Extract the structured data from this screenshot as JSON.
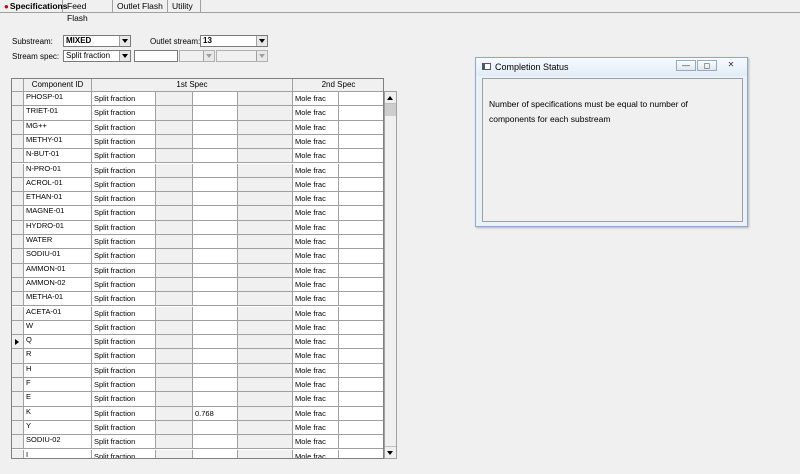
{
  "tabs": [
    {
      "label": "Specifications",
      "active": true
    },
    {
      "label": "Feed Flash",
      "active": false
    },
    {
      "label": "Outlet Flash",
      "active": false
    },
    {
      "label": "Utility",
      "active": false
    }
  ],
  "form": {
    "substream_label": "Substream:",
    "substream_value": "MIXED",
    "outlet_label": "Outlet stream:",
    "outlet_value": "13",
    "streamspec_label": "Stream spec:",
    "streamspec_value": "Split fraction"
  },
  "grid": {
    "headers": {
      "component": "Component ID",
      "spec1": "1st Spec",
      "spec2": "2nd Spec"
    },
    "selected_row_index": 17,
    "rows": [
      {
        "id": "PHOSP-01",
        "spec1": "Split fraction",
        "value": "",
        "spec2": "Mole frac"
      },
      {
        "id": "TRIET-01",
        "spec1": "Split fraction",
        "value": "",
        "spec2": "Mole frac"
      },
      {
        "id": "MG++",
        "spec1": "Split fraction",
        "value": "",
        "spec2": "Mole frac"
      },
      {
        "id": "METHY-01",
        "spec1": "Split fraction",
        "value": "",
        "spec2": "Mole frac"
      },
      {
        "id": "N-BUT-01",
        "spec1": "Split fraction",
        "value": "",
        "spec2": "Mole frac"
      },
      {
        "id": "N-PRO-01",
        "spec1": "Split fraction",
        "value": "",
        "spec2": "Mole frac"
      },
      {
        "id": "ACROL-01",
        "spec1": "Split fraction",
        "value": "",
        "spec2": "Mole frac"
      },
      {
        "id": "ETHAN-01",
        "spec1": "Split fraction",
        "value": "",
        "spec2": "Mole frac"
      },
      {
        "id": "MAGNE-01",
        "spec1": "Split fraction",
        "value": "",
        "spec2": "Mole frac"
      },
      {
        "id": "HYDRO-01",
        "spec1": "Split fraction",
        "value": "",
        "spec2": "Mole frac"
      },
      {
        "id": "WATER",
        "spec1": "Split fraction",
        "value": "",
        "spec2": "Mole frac"
      },
      {
        "id": "SODIU-01",
        "spec1": "Split fraction",
        "value": "",
        "spec2": "Mole frac"
      },
      {
        "id": "AMMON-01",
        "spec1": "Split fraction",
        "value": "",
        "spec2": "Mole frac"
      },
      {
        "id": "AMMON-02",
        "spec1": "Split fraction",
        "value": "",
        "spec2": "Mole frac"
      },
      {
        "id": "METHA-01",
        "spec1": "Split fraction",
        "value": "",
        "spec2": "Mole frac"
      },
      {
        "id": "ACETA-01",
        "spec1": "Split fraction",
        "value": "",
        "spec2": "Mole frac"
      },
      {
        "id": "W",
        "spec1": "Split fraction",
        "value": "",
        "spec2": "Mole frac"
      },
      {
        "id": "Q",
        "spec1": "Split fraction",
        "value": "",
        "spec2": "Mole frac"
      },
      {
        "id": "R",
        "spec1": "Split fraction",
        "value": "",
        "spec2": "Mole frac"
      },
      {
        "id": "H",
        "spec1": "Split fraction",
        "value": "",
        "spec2": "Mole frac"
      },
      {
        "id": "F",
        "spec1": "Split fraction",
        "value": "",
        "spec2": "Mole frac"
      },
      {
        "id": "E",
        "spec1": "Split fraction",
        "value": "",
        "spec2": "Mole frac"
      },
      {
        "id": "K",
        "spec1": "Split fraction",
        "value": "0.768",
        "spec2": "Mole frac"
      },
      {
        "id": "Y",
        "spec1": "Split fraction",
        "value": "",
        "spec2": "Mole frac"
      },
      {
        "id": "SODIU-02",
        "spec1": "Split fraction",
        "value": "",
        "spec2": "Mole frac"
      },
      {
        "id": "I",
        "spec1": "Split fraction",
        "value": "",
        "spec2": "Mole frac"
      }
    ]
  },
  "dialog": {
    "title": "Completion Status",
    "message": "Number of specifications must be equal to number of components for each substream",
    "minimize_glyph": "—",
    "restore_glyph": "◻",
    "close_glyph": "✕"
  }
}
